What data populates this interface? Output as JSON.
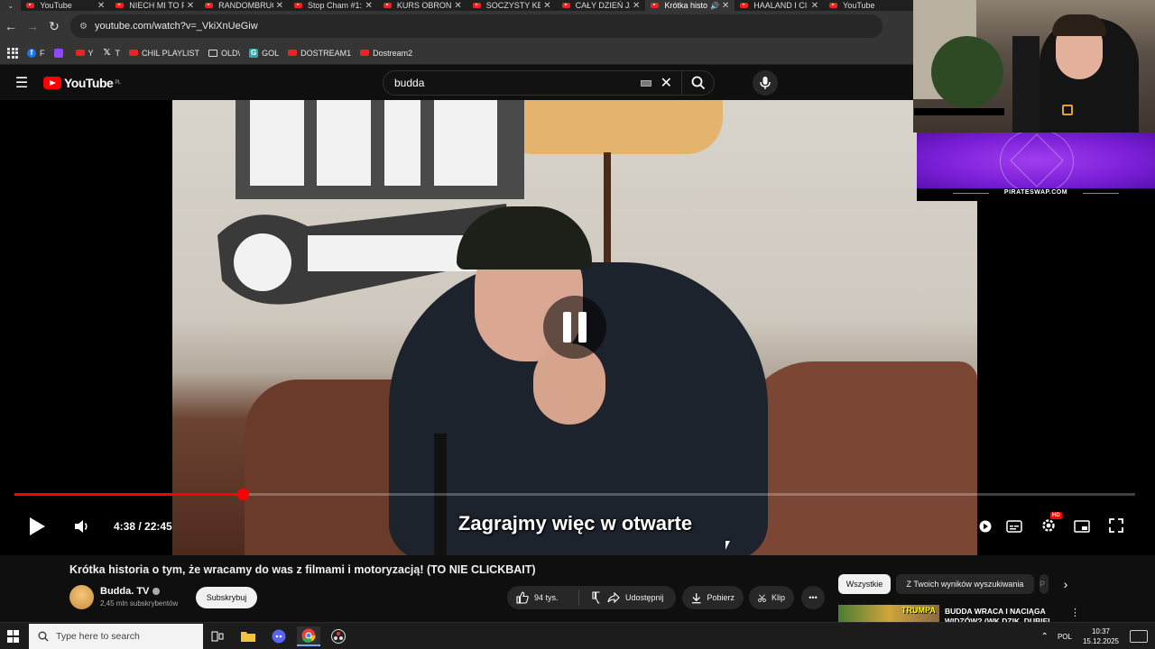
{
  "browser": {
    "tabs": [
      {
        "label": "YouTube",
        "active": false
      },
      {
        "label": "NIECH MI TO P",
        "active": false
      },
      {
        "label": "RANDOMBRUC",
        "active": false
      },
      {
        "label": "Stop Cham #1:",
        "active": false
      },
      {
        "label": "KURS OBRONI",
        "active": false
      },
      {
        "label": "SOCZYSTY KEB",
        "active": false
      },
      {
        "label": "CAŁY DZIEŃ JA",
        "active": false
      },
      {
        "label": "Krótka histo",
        "active": true,
        "audio": true
      },
      {
        "label": "HAALAND I CI",
        "active": false
      },
      {
        "label": "YouTube",
        "active": false
      }
    ],
    "url": "youtube.com/watch?v=_VkiXnUeGiw",
    "bookmarks": [
      {
        "label": "F",
        "icon": "facebook-icon"
      },
      {
        "label": "",
        "icon": "twitch-icon"
      },
      {
        "label": "Y",
        "icon": "youtube-icon"
      },
      {
        "label": "T",
        "icon": "x-icon"
      },
      {
        "label": "CHIL PLAYLIST",
        "icon": "youtube-icon"
      },
      {
        "label": "OLD\\",
        "icon": "folder-icon"
      },
      {
        "label": "GOL",
        "icon": "g-icon"
      },
      {
        "label": "DOSTREAM1",
        "icon": "youtube-icon"
      },
      {
        "label": "Dostream2",
        "icon": "youtube-icon"
      }
    ]
  },
  "youtube": {
    "logo_text": "YouTube",
    "region": "PL",
    "search_query": "budda"
  },
  "player": {
    "current_time": "4:38",
    "duration": "22:45",
    "time_display": "4:38 / 22:45",
    "progress_fraction": 0.204,
    "subtitle": "Zagrajmy więc w otwarte",
    "hd_badge": "HD",
    "state": "paused-indicator"
  },
  "video": {
    "title": "Krótka historia o tym, że wracamy do was z filmami i motoryzacją! (TO NIE CLICKBAIT)",
    "channel_name": "Budda. TV",
    "subscribers": "2,45 mln subskrybentów",
    "subscribe_label": "Subskrybuj",
    "likes": "94 tys.",
    "share_label": "Udostępnij",
    "download_label": "Pobierz",
    "clip_label": "Klip"
  },
  "sidebar": {
    "chips": [
      "Wszystkie",
      "Z Twoich wyników wyszukiwania",
      "P"
    ],
    "recommended": [
      {
        "title": "BUDDA WRACA I NACIĄGA WIDZÓW? (WK DZIK, DUBIEL",
        "thumb_text": "TRUMPA"
      }
    ]
  },
  "overlay": {
    "ad_domain": "PIRATESWAP.COM"
  },
  "taskbar": {
    "search_placeholder": "Type here to search",
    "language": "POL",
    "time": "10:37",
    "date": "15.12.2025"
  }
}
